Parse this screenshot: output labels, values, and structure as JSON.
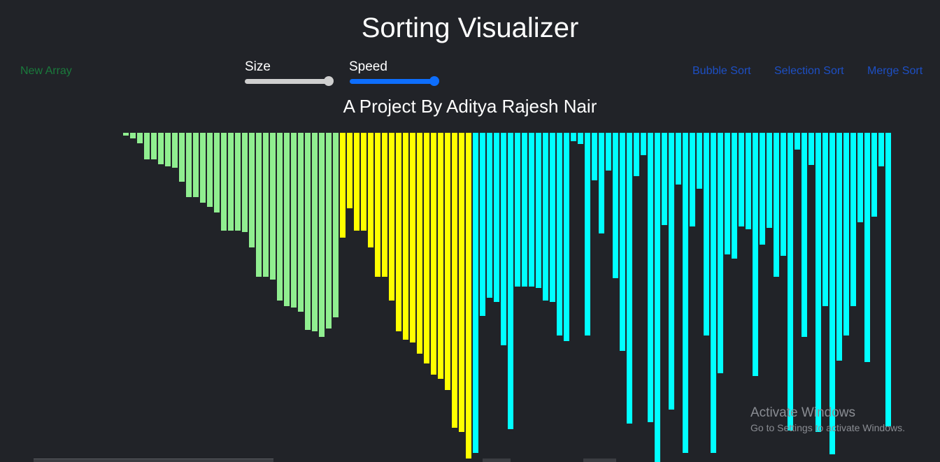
{
  "header": {
    "title": "Sorting Visualizer",
    "subtitle": "A Project By Aditya Rajesh Nair"
  },
  "controls": {
    "new_array_label": "New Array",
    "size_label": "Size",
    "speed_label": "Speed",
    "size_value_fraction": 0.96,
    "speed_value_fraction": 0.96
  },
  "algorithms": [
    {
      "label": "Bubble Sort"
    },
    {
      "label": "Selection Sort"
    },
    {
      "label": "Merge Sort"
    }
  ],
  "colors": {
    "sorted_left": "#90ee90",
    "merge_section": "#ffff00",
    "unsorted": "#00ffff",
    "background": "#212328",
    "new_array_link": "#1a7a3c",
    "sort_link": "#1d4fc4",
    "speed_slider": "#0d6efd",
    "size_slider": "#cfcfcf"
  },
  "bars": {
    "green": [
      4,
      8,
      15,
      38,
      38,
      45,
      48,
      50,
      70,
      92,
      92,
      100,
      106,
      114,
      140,
      140,
      140,
      142,
      164,
      206,
      206,
      210,
      240,
      248,
      250,
      256,
      282,
      284,
      292,
      280,
      264
    ],
    "yellow": [
      150,
      108,
      140,
      140,
      164,
      206,
      206,
      240,
      284,
      296,
      300,
      316,
      330,
      346,
      352,
      368,
      422,
      428,
      466
    ],
    "cyan": [
      458,
      262,
      236,
      242,
      304,
      424,
      220,
      220,
      220,
      222,
      240,
      242,
      290,
      298,
      12,
      16,
      290,
      68,
      144,
      54,
      208,
      312,
      416,
      62,
      32,
      414,
      646,
      132,
      396,
      74,
      458,
      134,
      80,
      290,
      458,
      344,
      174,
      180,
      134,
      138,
      348,
      160,
      136,
      206,
      176,
      426,
      24,
      292,
      46,
      428,
      248,
      460,
      326,
      290,
      248,
      128,
      328,
      120,
      48,
      420
    ]
  },
  "watermark": {
    "title": "Activate Windows",
    "subtitle": "Go to Settings to activate Windows."
  }
}
